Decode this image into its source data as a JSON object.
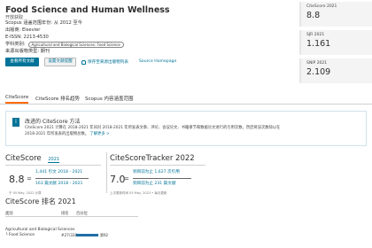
{
  "header": {
    "title": "Food Science and Human Wellness",
    "subtitle": "开放获取",
    "coverage": "Scopus 涵盖范围年份: 从 2012 至今",
    "publisher": "出版商:  Elsevier",
    "issn": "E-ISSN:  2213-4530",
    "subject_label": "学科类别:",
    "subject_chip": "Agricultural and Biological Sciences: Food Science",
    "source_type": "来源出版物类型:  期刊"
  },
  "buttons": {
    "view_all": "查看所有文献",
    "set_alert": "设置文献提醒",
    "save_list": "保存至来源出版物列表",
    "homepage": "Source Homepage"
  },
  "metrics": [
    {
      "label": "CiteScore 2021",
      "value": "8.8"
    },
    {
      "label": "SJR 2021",
      "value": "1.161"
    },
    {
      "label": "SNIP 2021",
      "value": "2.109"
    }
  ],
  "tabs": [
    "CiteScore",
    "CiteScore 排名趋势",
    "Scopus 内容涵盖范围"
  ],
  "info": {
    "icon": "i",
    "title": "改进的 CiteScore 方法",
    "text": "CiteScore 2021 计算在 2018-2021 年间对 2018-2021 年所发表文章、评论、会议论文、书籍章节和数据论文进行的引用次数，然后将该次数除以在 2018-2021 年所发表的出版物总数。",
    "more": "了解更多 >"
  },
  "citescore": {
    "title": "CiteScore",
    "year": "2021",
    "value": "8.8",
    "eq": "=",
    "numerator": "1,441 引文 2018 - 2021",
    "denominator": "163 篇文献 2018 - 2021",
    "note": "于 05 May, 2022 计算"
  },
  "tracker": {
    "title": "CiteScoreTracker 2022",
    "value": "7.0",
    "eq": "=",
    "numerator": "到目前为止 1,627 次引用",
    "denominator": "到目前为止 231 篇文献",
    "note": "上次更新时间 05 May, 2023 • 每月更新"
  },
  "rank": {
    "title": "CiteScore 排名 2021",
    "headers": [
      "类别",
      "排名",
      "百分位"
    ],
    "category": "Agricultural and Biological Sciences",
    "subcategory": "└ Food Science",
    "rank_text": "#27/338",
    "percentile": "第92"
  },
  "colors": {
    "accent": "#007398",
    "tab_active": "#ff6c00",
    "bar": "#1f6fa5"
  }
}
